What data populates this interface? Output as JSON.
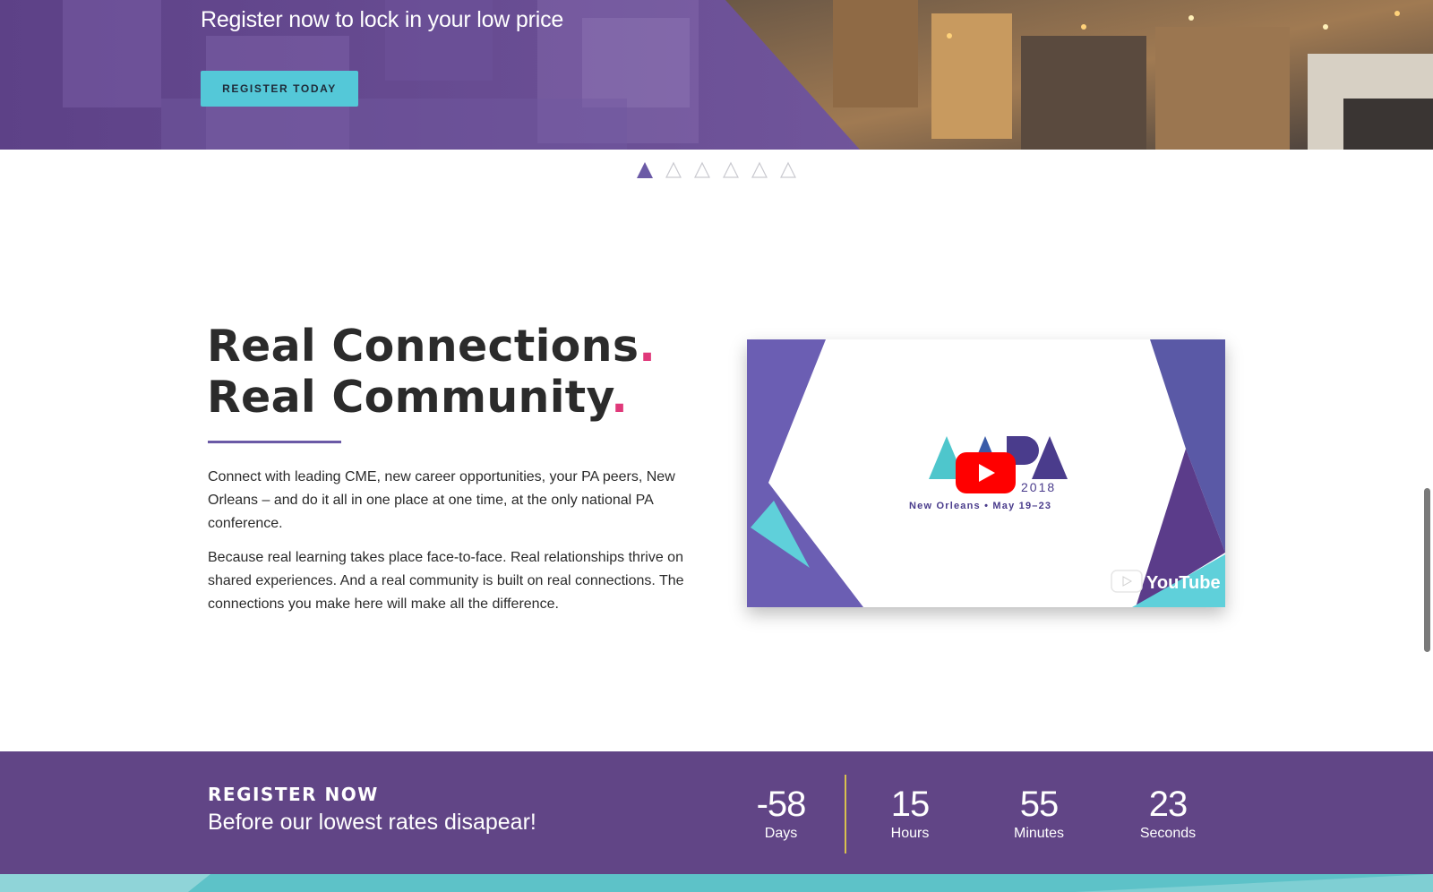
{
  "hero": {
    "subtitle": "Register now to lock in your low price",
    "register_button": "REGISTER TODAY",
    "slide_count": 6,
    "active_slide": 1
  },
  "intro": {
    "headline_line1": "Real Connections",
    "headline_line2": "Real Community",
    "punctuation": ".",
    "paragraph1": "Connect with leading CME, new career opportunities, your PA peers, New Orleans – and do it all in one place at one time, at the only national PA conference.",
    "paragraph2": "Because real learning takes place face-to-face. Real relationships thrive on shared experiences. And a real community is built on real connections. The connections you make here will make all the difference."
  },
  "video": {
    "logo_year": "2018",
    "logo_tagline": "New Orleans • May 19–23",
    "youtube_label": "YouTube"
  },
  "countdown": {
    "title": "REGISTER NOW",
    "subtitle": "Before our lowest rates disapear!",
    "days": "-58",
    "days_label": "Days",
    "hours": "15",
    "hours_label": "Hours",
    "minutes": "55",
    "minutes_label": "Minutes",
    "seconds": "23",
    "seconds_label": "Seconds"
  },
  "colors": {
    "purple": "#614586",
    "accent_teal": "#54c8d8",
    "accent_pink": "#e0397a",
    "accent_gold": "#d9c14e"
  }
}
